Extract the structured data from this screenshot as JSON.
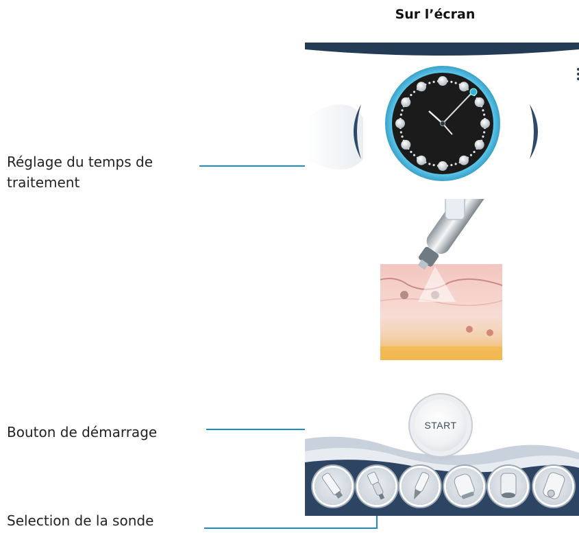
{
  "heading": "Sur l’écran",
  "annotations": {
    "treatment_time_line1": "Réglage du temps de",
    "treatment_time_line2": "traitement",
    "start_button": "Bouton de démarrage",
    "probe_selection": "Selection de la sonde"
  },
  "screen": {
    "start_label": "START",
    "probes": [
      "probe-1",
      "probe-2",
      "probe-3",
      "probe-4",
      "probe-5",
      "probe-6"
    ],
    "icons": {
      "menu": "hamburger-menu-icon",
      "prev": "chevron-left-icon",
      "next": "chevron-right-icon"
    }
  },
  "colors": {
    "leader": "#1e8bc3",
    "navy": "#243b55",
    "clock_ring": "#4fb8dc",
    "clock_face": "#1b1b1b"
  }
}
